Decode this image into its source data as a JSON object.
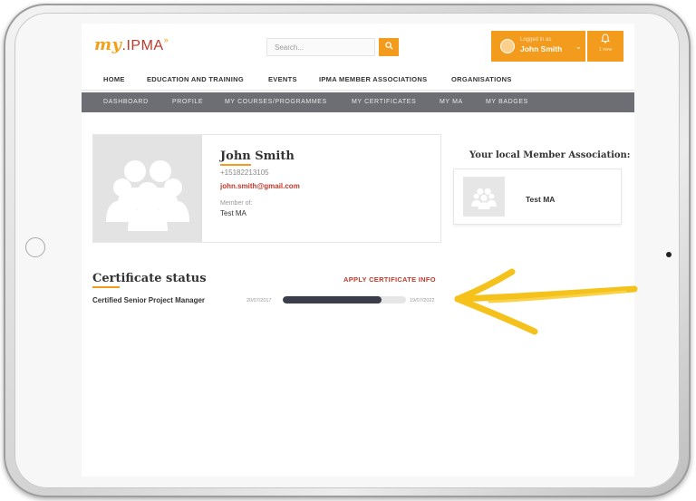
{
  "header": {
    "logo": {
      "my": "my",
      "rest": ".IPMA",
      "mark": "»"
    },
    "search": {
      "placeholder": "Search..."
    },
    "user": {
      "logged_in_as": "Logged in as",
      "name": "John Smith"
    },
    "notifications": {
      "count_label": "1 new"
    }
  },
  "main_nav": [
    "HOME",
    "EDUCATION AND TRAINING",
    "EVENTS",
    "IPMA MEMBER ASSOCIATIONS",
    "ORGANISATIONS"
  ],
  "sub_nav": [
    "DASHBOARD",
    "PROFILE",
    "MY COURSES/PROGRAMMES",
    "MY CERTIFICATES",
    "MY MA",
    "MY BADGES"
  ],
  "profile": {
    "name": "John Smith",
    "phone": "+15182213105",
    "email": "john.smith@gmail.com",
    "member_of_label": "Member of:",
    "member_of": "Test MA"
  },
  "local_ma": {
    "title": "Your local Member Association:",
    "name": "Test MA"
  },
  "certificate_status": {
    "title": "Certificate status",
    "apply_link": "APPLY CERTIFICATE INFO",
    "items": [
      {
        "name": "Certified Senior Project Manager",
        "start": "20/07/2017",
        "end": "19/07/2022",
        "progress": 0.8
      }
    ]
  },
  "colors": {
    "accent": "#f29b1d",
    "link": "#c0392b",
    "subnav": "#6d6e73",
    "progress": "#3c3d4a",
    "annotation": "#f5c21b"
  },
  "icons": [
    "search-icon",
    "avatar-icon",
    "chevron-down-icon",
    "bell-icon",
    "group-placeholder-icon",
    "annotation-arrow"
  ]
}
